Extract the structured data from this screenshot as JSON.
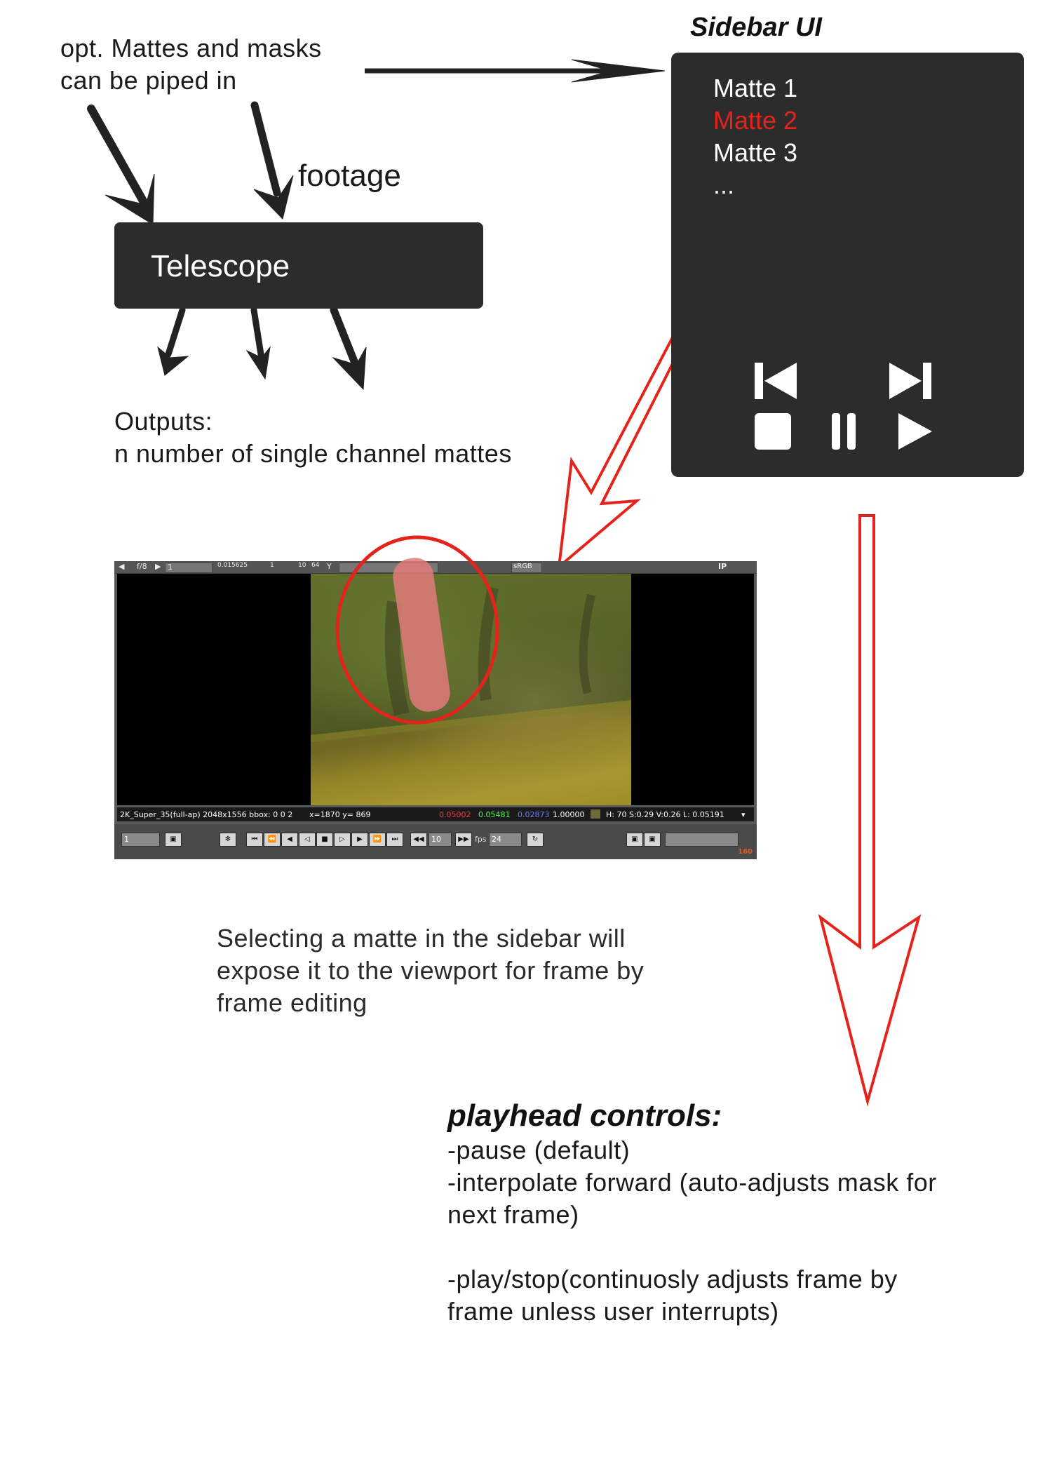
{
  "inputs_note": {
    "line1": "opt. Mattes and masks",
    "line2": "can be piped in"
  },
  "footage_label": "footage",
  "telescope": {
    "label": "Telescope"
  },
  "outputs_note": {
    "line1": "Outputs:",
    "line2": "n number of single channel mattes"
  },
  "sidebar": {
    "title": "Sidebar UI",
    "mattes": [
      {
        "label": "Matte 1",
        "selected": false
      },
      {
        "label": "Matte 2",
        "selected": true
      },
      {
        "label": "Matte 3",
        "selected": false
      },
      {
        "label": "...",
        "selected": false
      }
    ],
    "buttons": [
      "skip-back-icon",
      "skip-forward-icon",
      "stop-icon",
      "pause-icon",
      "play-icon"
    ]
  },
  "viewer": {
    "toolbar": {
      "fstop": "f/8",
      "frame": "1",
      "gain": "0.015625",
      "scale_1": "1",
      "scale_10": "10",
      "scale_64": "64",
      "channel": "Y",
      "colorspace": "sRGB",
      "ip": "IP"
    },
    "status": {
      "format": "2K_Super_35(full-ap) 2048x1556 bbox: 0 0 2",
      "coords": "x=1870 y= 869",
      "r": "0.05002",
      "g": "0.05481",
      "b": "0.02873",
      "a": "1.00000",
      "hsvl": "H: 70 S:0.29 V:0.26  L: 0.05191"
    },
    "controls": {
      "frame": "1",
      "increment": "10",
      "fps_label": "fps",
      "fps": "24",
      "end_frame": "160"
    },
    "colors": {
      "r": "#ff3b3b",
      "g": "#4cff4c",
      "b": "#5a6bff"
    }
  },
  "explanation": {
    "line1": "Selecting a matte in the sidebar will",
    "line2": "expose it to the viewport for frame by",
    "line3": "frame editing"
  },
  "playhead": {
    "title": "playhead controls:",
    "items": [
      "-pause (default)",
      "-interpolate forward (auto-adjusts mask for",
      "next frame)",
      "",
      "-play/stop(continuosly adjusts frame by",
      "frame unless user interrupts)"
    ]
  },
  "colors": {
    "accent": "#e4231b",
    "panel": "#2c2c2c"
  }
}
